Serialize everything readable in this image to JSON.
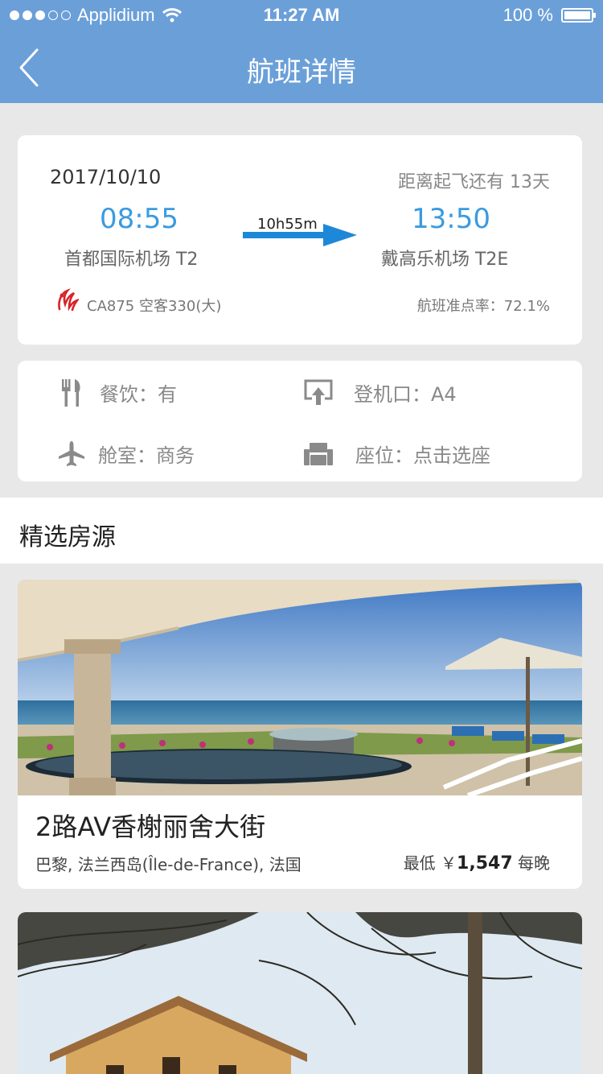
{
  "status_bar": {
    "carrier": "Applidium",
    "time": "11:27 AM",
    "battery": "100 %",
    "signal_dots": [
      true,
      true,
      true,
      false,
      false
    ]
  },
  "nav": {
    "back_icon": "chevron-left-icon",
    "title": "航班详情"
  },
  "flight": {
    "date": "2017/10/10",
    "countdown": "距离起飞还有  13天",
    "departure_time": "08:55",
    "departure_airport": "首都国际机场 T2",
    "arrival_time": "13:50",
    "arrival_airport": "戴高乐机场 T2E",
    "duration": "10h55m",
    "flight_info": "CA875 空客330(大)",
    "on_time_rate": "航班准点率：72.1%",
    "airline_logo": "air-china-logo",
    "accent_color": "#3a9be0",
    "arrow_color": "#1e88d8"
  },
  "details": {
    "meal": "餐饮：有",
    "gate": "登机口：A4",
    "cabin": "舱室：商务",
    "seat": "座位：点击选座"
  },
  "section": {
    "title": "精选房源"
  },
  "listings": [
    {
      "title": "2路AV香榭丽舍大街",
      "location": "巴黎, 法兰西岛(Île-de-France), 法国",
      "price_prefix": "最低 ￥",
      "price": "1,547",
      "price_suffix": "每晚"
    }
  ],
  "colors": {
    "header": "#6b9fd8",
    "background": "#e8e8e8"
  }
}
